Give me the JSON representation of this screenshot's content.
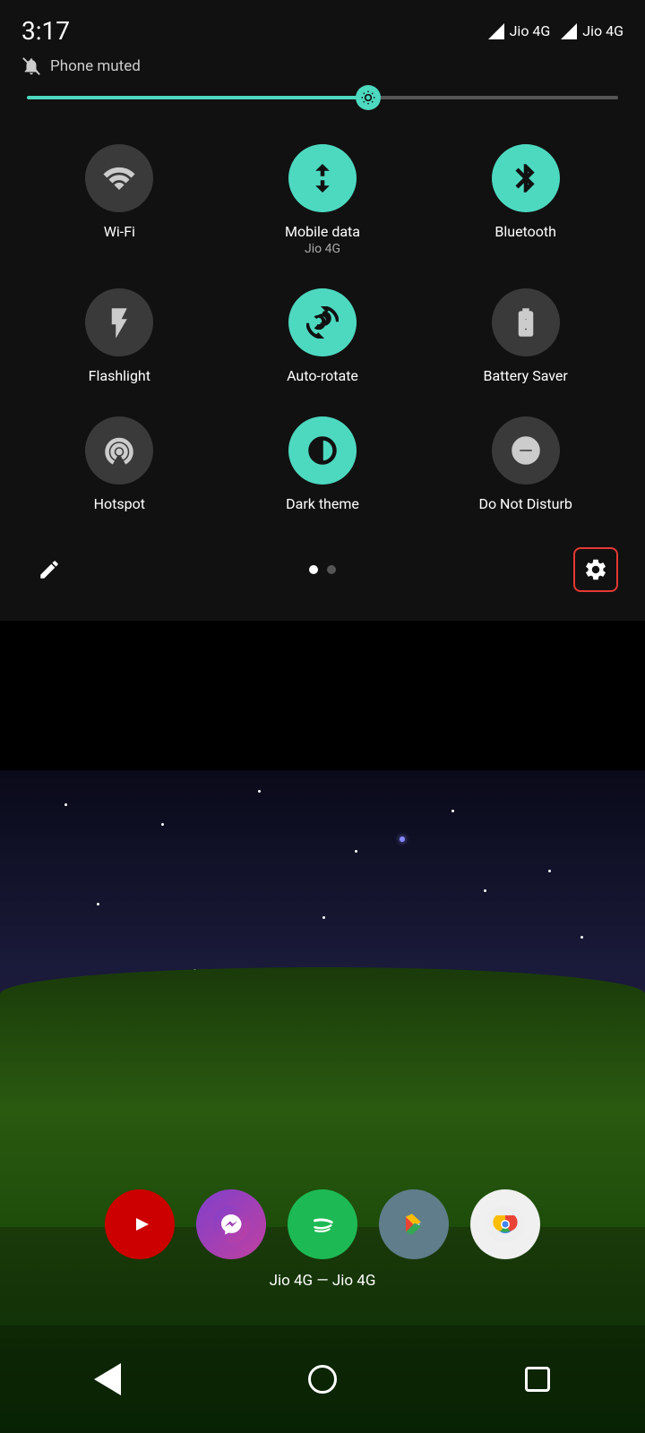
{
  "statusBar": {
    "time": "3:17",
    "notification": "Phone muted",
    "signal1": "Jio 4G",
    "signal2": "Jio 4G"
  },
  "brightness": {
    "value": 58
  },
  "tiles": [
    {
      "id": "wifi",
      "label": "Wi-Fi",
      "sublabel": "",
      "active": false
    },
    {
      "id": "mobiledata",
      "label": "Mobile data",
      "sublabel": "Jio 4G",
      "active": true
    },
    {
      "id": "bluetooth",
      "label": "Bluetooth",
      "sublabel": "",
      "active": true
    },
    {
      "id": "flashlight",
      "label": "Flashlight",
      "sublabel": "",
      "active": false
    },
    {
      "id": "autorotate",
      "label": "Auto-rotate",
      "sublabel": "",
      "active": true
    },
    {
      "id": "batterysaver",
      "label": "Battery Saver",
      "sublabel": "",
      "active": false
    },
    {
      "id": "hotspot",
      "label": "Hotspot",
      "sublabel": "",
      "active": false
    },
    {
      "id": "darktheme",
      "label": "Dark theme",
      "sublabel": "",
      "active": true
    },
    {
      "id": "donotdisturb",
      "label": "Do Not Disturb",
      "sublabel": "",
      "active": false
    }
  ],
  "bottom": {
    "editLabel": "✏",
    "settingsLabel": "⚙",
    "dots": [
      true,
      false
    ]
  },
  "dock": {
    "networkLabel": "Jio 4G — Jio 4G",
    "apps": [
      {
        "id": "youtube",
        "color": "#cc0000",
        "icon": "▶"
      },
      {
        "id": "messenger",
        "color": "#8040aa",
        "icon": "💬"
      },
      {
        "id": "spotify",
        "color": "#1db954",
        "icon": "♪"
      },
      {
        "id": "play",
        "color": "#607d8b",
        "icon": "▷"
      },
      {
        "id": "chrome",
        "color": "#4285f4",
        "icon": "◉"
      }
    ]
  }
}
